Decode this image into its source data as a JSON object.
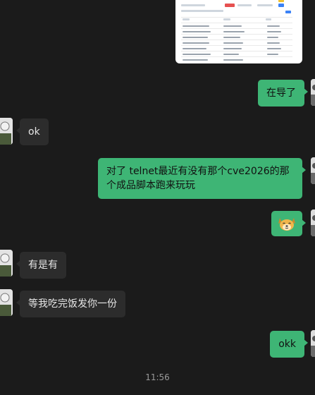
{
  "messages": [
    {
      "side": "me",
      "kind": "image"
    },
    {
      "side": "me",
      "text": "在导了"
    },
    {
      "side": "them",
      "text": "ok"
    },
    {
      "side": "me",
      "text": "对了 telnet最近有没有那个cve2026的那个成品脚本跑来玩玩"
    },
    {
      "side": "me",
      "kind": "sticker",
      "sticker": "dog-face-emoji"
    },
    {
      "side": "them",
      "text": "有是有"
    },
    {
      "side": "them",
      "text": "等我吃完饭发你一份"
    },
    {
      "side": "me",
      "text": "okk"
    }
  ],
  "timestamp": "11:56",
  "colors": {
    "background": "#1b1b1b",
    "my_bubble": "#3eb575",
    "their_bubble": "#2c2c2c",
    "timestamp": "#9a9a9a"
  }
}
